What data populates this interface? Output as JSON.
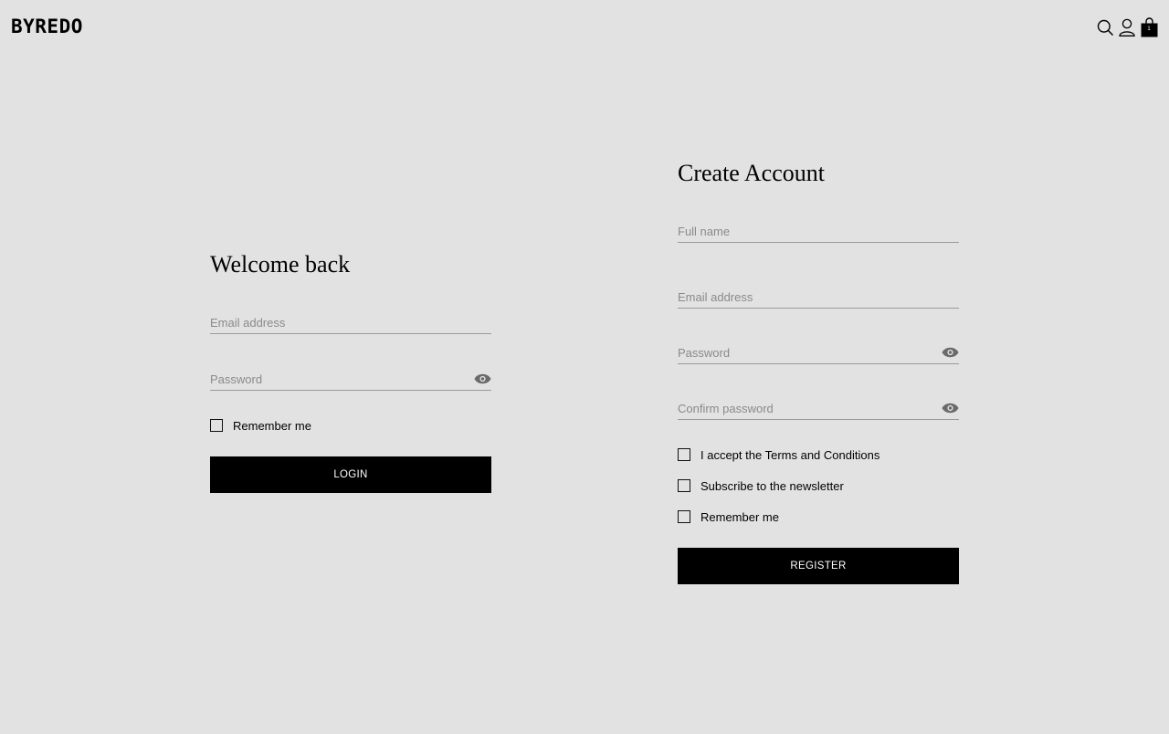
{
  "header": {
    "logo": "BYREDO",
    "icons": [
      "search-icon",
      "account-icon",
      "cart-icon"
    ],
    "cart_count": "1"
  },
  "login": {
    "title": "Welcome back",
    "email_placeholder": "Email address",
    "password_placeholder": "Password",
    "remember_label": "Remember me",
    "submit_label": "LOGIN"
  },
  "register": {
    "title": "Create Account",
    "fullname_placeholder": "Full name",
    "email_placeholder": "Email address",
    "password_placeholder": "Password",
    "confirm_placeholder": "Confirm password",
    "terms_label": "I accept the Terms and Conditions",
    "newsletter_label": "Subscribe to the newsletter",
    "remember_label": "Remember me",
    "submit_label": "REGISTER"
  },
  "colors": {
    "background": "#e2e2e2",
    "button": "#000000",
    "placeholder": "#8a8a8a"
  }
}
